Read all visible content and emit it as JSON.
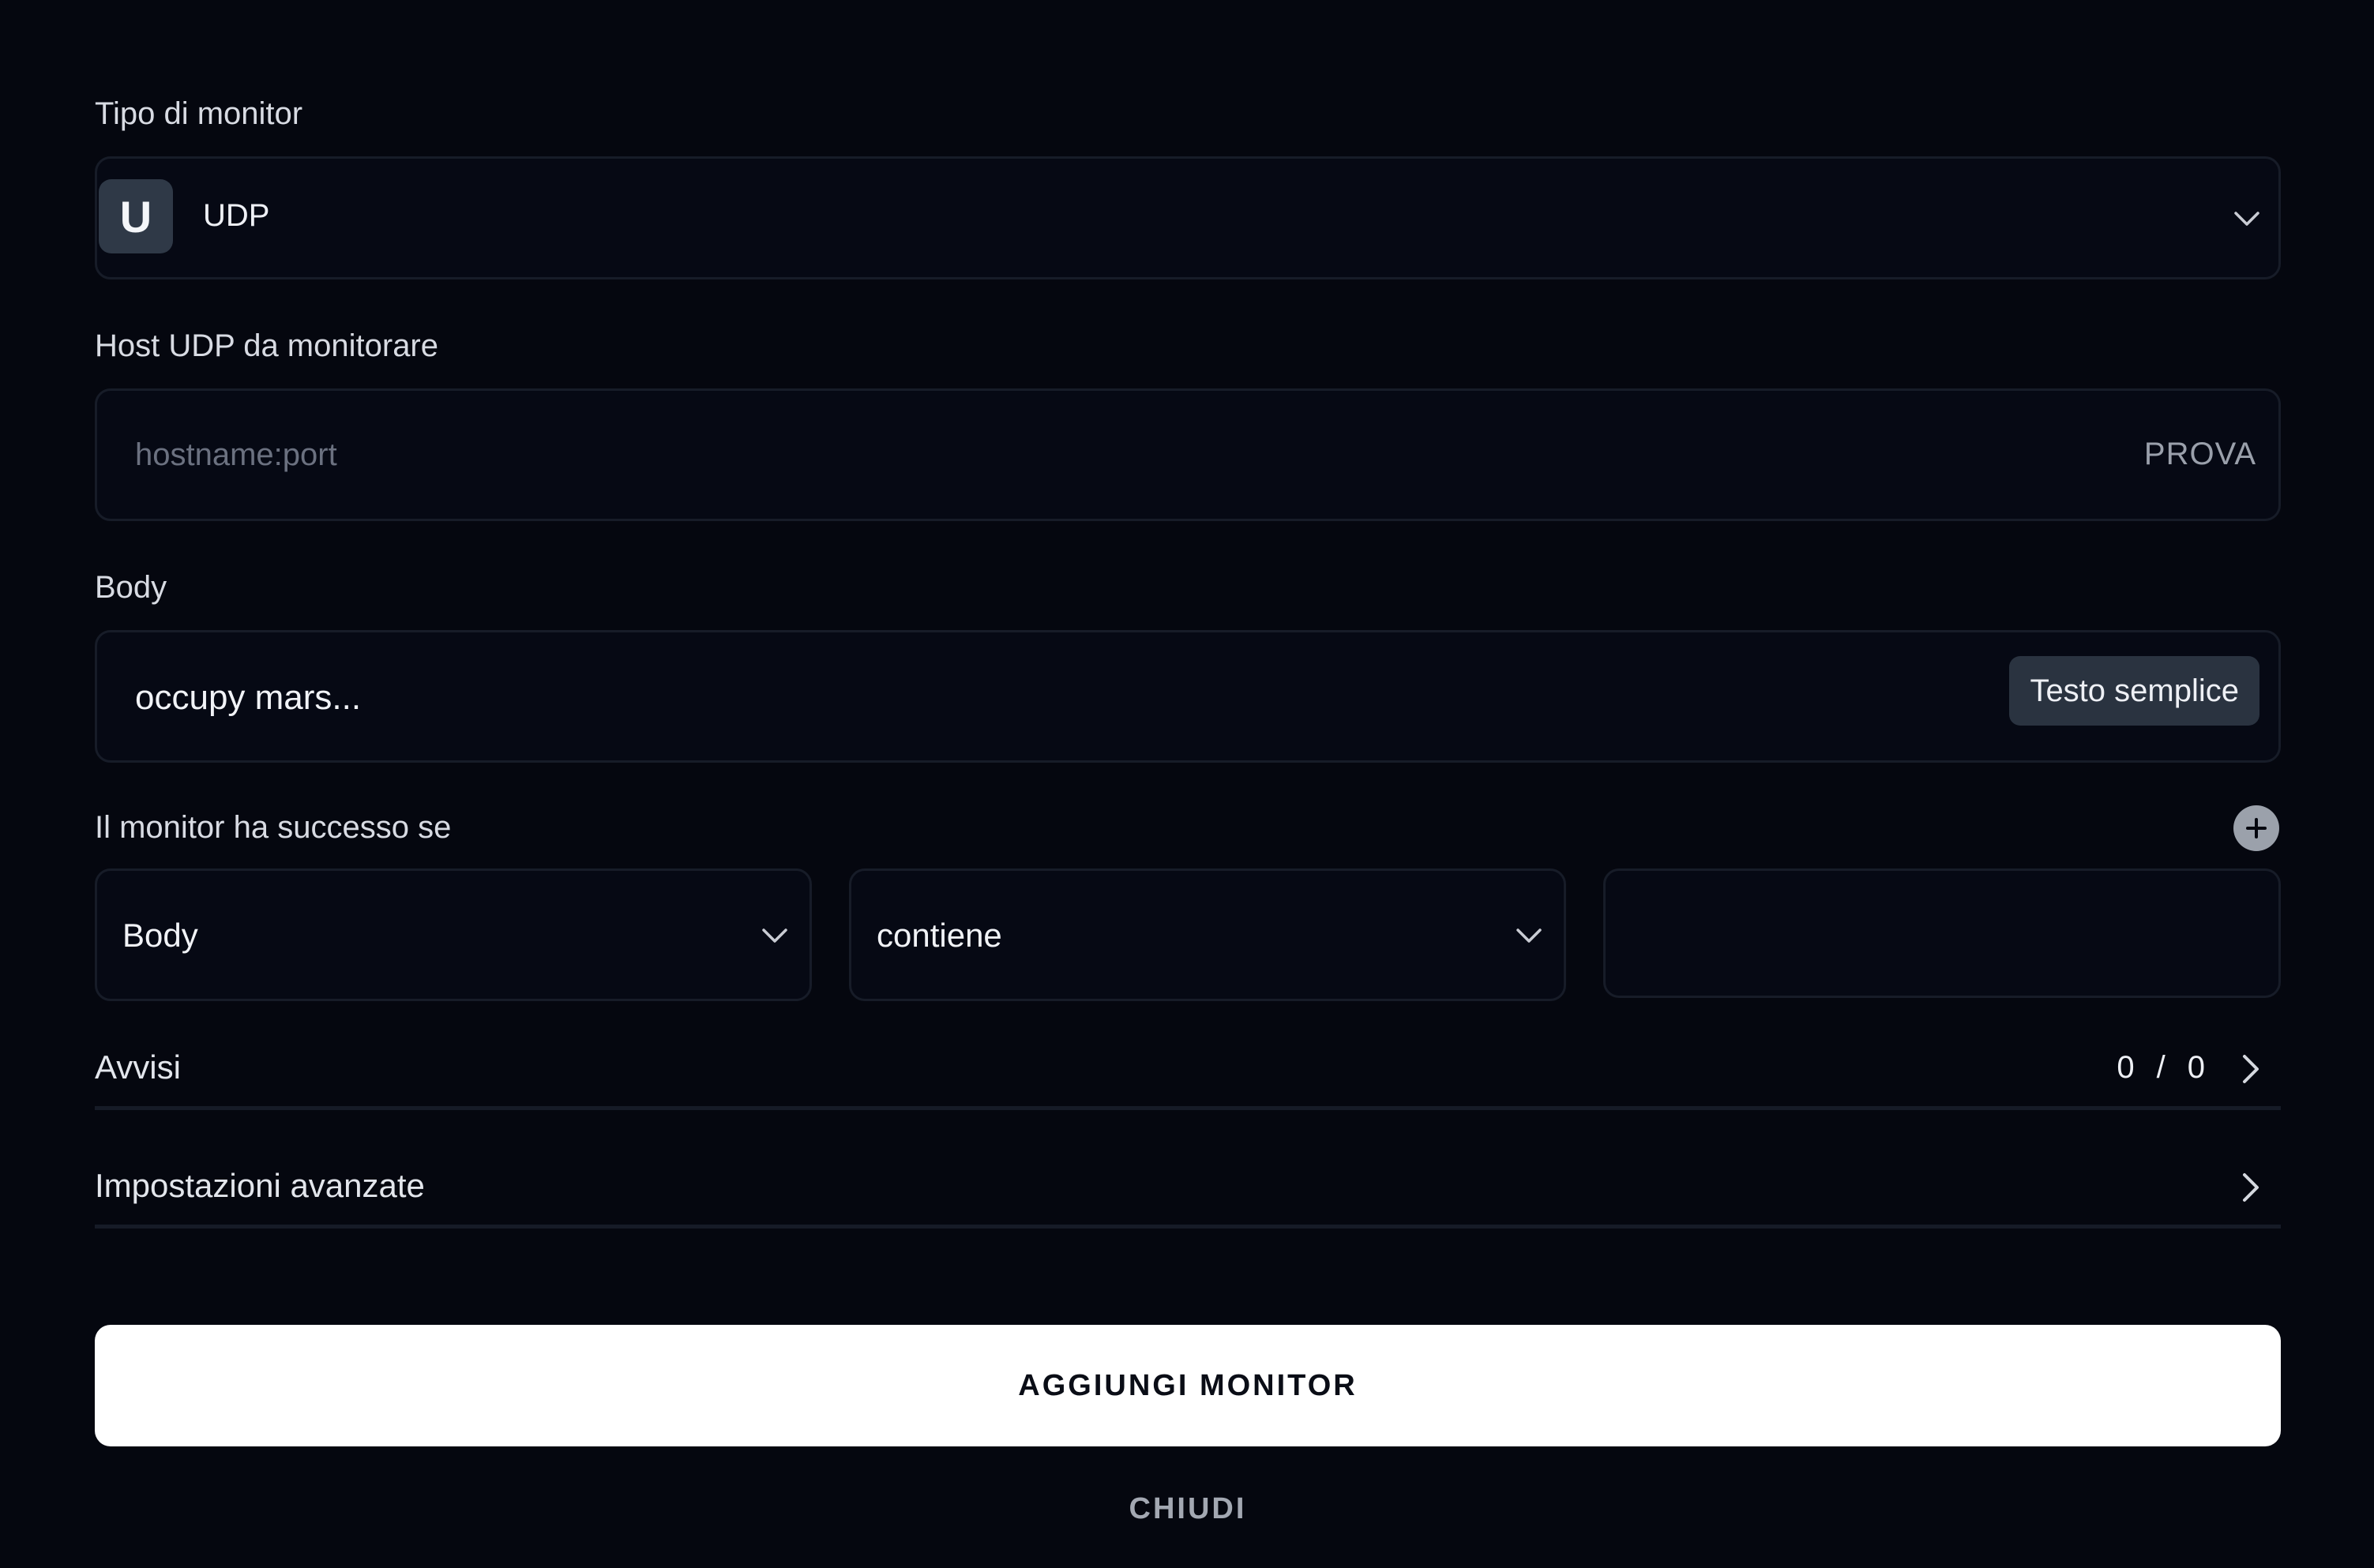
{
  "monitor_type": {
    "label": "Tipo di monitor",
    "badge_letter": "U",
    "value": "UDP",
    "icon": "chevron-down-icon"
  },
  "host": {
    "label": "Host UDP da monitorare",
    "placeholder": "hostname:port",
    "value": "",
    "test_label": "PROVA"
  },
  "body": {
    "label": "Body",
    "value": "occupy mars...",
    "mode_label": "Testo semplice"
  },
  "success": {
    "label": "Il monitor ha successo se",
    "add_icon": "plus-icon",
    "field": "Body",
    "operator": "contiene",
    "value": ""
  },
  "alerts": {
    "label": "Avvisi",
    "active": "0",
    "separator": "/",
    "total": "0"
  },
  "advanced": {
    "label": "Impostazioni avanzate"
  },
  "actions": {
    "submit_label": "AGGIUNGI MONITOR",
    "close_label": "CHIUDI"
  },
  "colors": {
    "background": "#05070f",
    "field_background": "#060914",
    "border": "#171c28",
    "badge": "#2f3947",
    "primary_button": "#ffffff"
  }
}
